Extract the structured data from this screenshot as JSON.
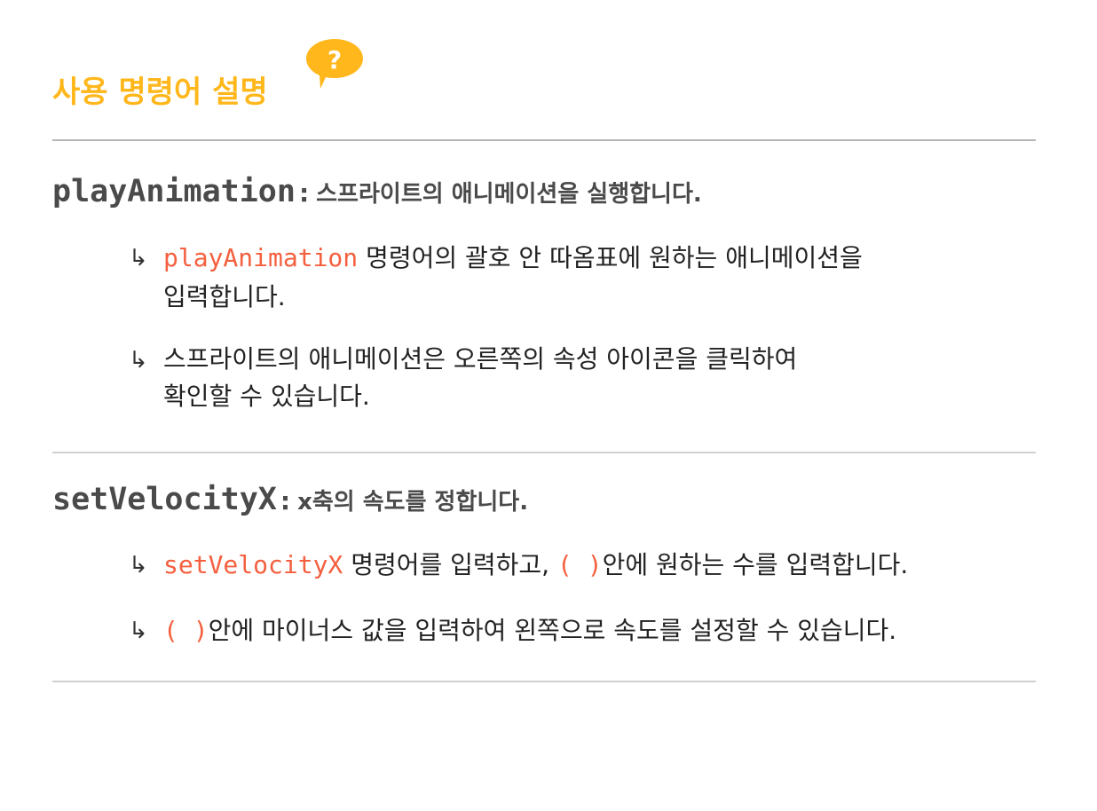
{
  "header": {
    "title": "사용 명령어 설명",
    "help_icon_glyph": "?",
    "accent_color": "#ffb71b"
  },
  "commands": [
    {
      "name": "playAnimation",
      "colon": ":",
      "description": "스프라이트의 애니메이션을 실행합니다.",
      "bullets": [
        {
          "code": "playAnimation",
          "text_line1": " 명령어의 괄호 안 따옴표에 원하는 애니메이션을",
          "text_line2": "입력합니다."
        },
        {
          "text_line1": "스프라이트의 애니메이션은 오른쪽의 속성 아이콘을 클릭하여",
          "text_line2": "확인할 수 있습니다."
        }
      ]
    },
    {
      "name": "setVelocityX",
      "colon": ":",
      "description": "x축의 속도를 정합니다.",
      "bullets": [
        {
          "code": "setVelocityX",
          "text_a": " 명령어를 입력하고, ",
          "paren": "( )",
          "text_b": "안에 원하는 수를 입력합니다."
        },
        {
          "paren": "( )",
          "text": "안에 마이너스 값을 입력하여 왼쪽으로 속도를 설정할 수 있습니다."
        }
      ]
    }
  ],
  "bullet_arrow_glyph": "↳",
  "code_color": "#f4603f"
}
